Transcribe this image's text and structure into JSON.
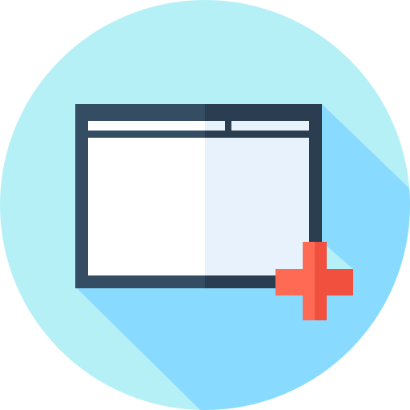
{
  "icon": {
    "name": "new-window-icon",
    "parts": [
      "window-icon",
      "plus-icon"
    ]
  },
  "colors": {
    "circle_background": "#B4F0F5",
    "long_shadow": "#89DAFF",
    "window_frame_left": "#344D63",
    "window_frame_right": "#2B3D51",
    "window_pane_left": "#FFFFFF",
    "window_pane_right": "#E8F2FC",
    "plus_left": "#FF6A55",
    "plus_right": "#F2503F"
  }
}
